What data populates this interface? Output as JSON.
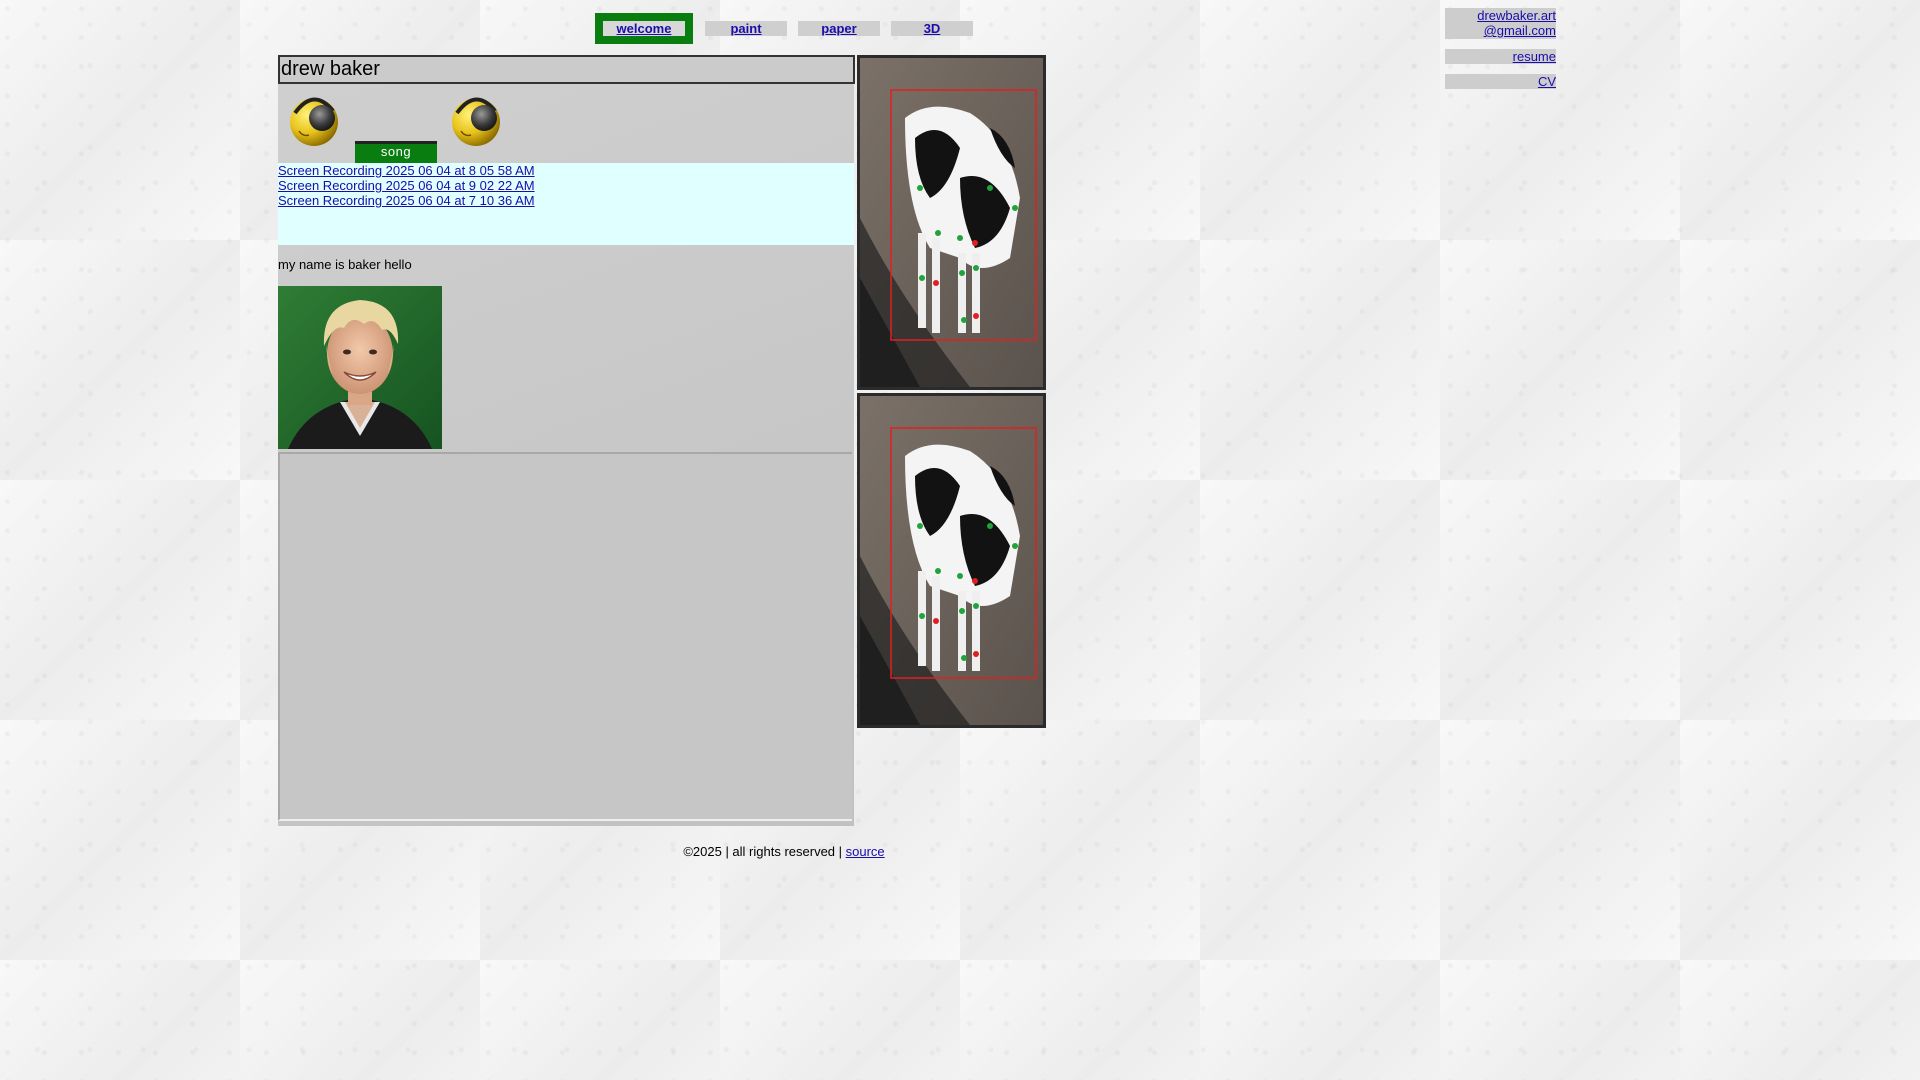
{
  "nav": {
    "tabs": [
      {
        "label": "welcome",
        "active": true
      },
      {
        "label": "paint",
        "active": false
      },
      {
        "label": "paper",
        "active": false
      },
      {
        "label": "3D",
        "active": false
      }
    ]
  },
  "side_links": {
    "email_line1": "drewbaker.art",
    "email_line2": "@gmail.com",
    "resume": "resume",
    "cv": "CV"
  },
  "main": {
    "title": "drew baker",
    "song_button": "song",
    "recordings": [
      "Screen Recording 2025 06 04 at 8 05 58 AM",
      "Screen Recording 2025 06 04 at 9 02 22 AM",
      "Screen Recording 2025 06 04 at 7 10 36 AM"
    ],
    "intro": "my name is baker hello"
  },
  "footer": {
    "text": "©2025 | all rights reserved | ",
    "source_link": "source"
  },
  "colors": {
    "accent_green": "#0a7d10",
    "link_blue": "#1a0dab",
    "recordings_bg": "#e0ffff"
  }
}
